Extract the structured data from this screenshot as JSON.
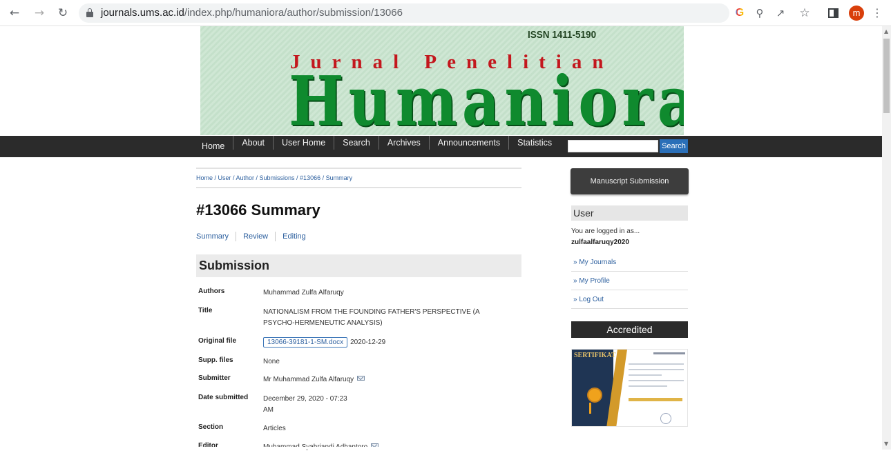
{
  "browser": {
    "url_host": "journals.ums.ac.id",
    "url_path": "/index.php/humaniora/author/submission/13066",
    "avatar_letter": "m"
  },
  "banner": {
    "issn": "ISSN 1411-5190",
    "subtitle": "Jurnal Penelitian",
    "title": "Humaniora"
  },
  "nav": {
    "items": [
      "Home",
      "About",
      "User Home",
      "Search",
      "Archives",
      "Announcements",
      "Statistics"
    ],
    "search_button": "Search"
  },
  "breadcrumb": "Home / User / Author / Submissions / #13066 / Summary",
  "page_title": "#13066 Summary",
  "tabs": [
    "Summary",
    "Review",
    "Editing"
  ],
  "section_title": "Submission",
  "submission": {
    "authors_label": "Authors",
    "authors": "Muhammad Zulfa Alfaruqy",
    "title_label": "Title",
    "title": "NATIONALISM FROM THE FOUNDING FATHER'S PERSPECTIVE (A PSYCHO-HERMENEUTIC ANALYSIS)",
    "original_file_label": "Original file",
    "original_file": "13066-39181-1-SM.docx",
    "original_file_date": "2020-12-29",
    "supp_files_label": "Supp. files",
    "supp_files": "None",
    "submitter_label": "Submitter",
    "submitter": "Mr Muhammad Zulfa Alfaruqy",
    "date_submitted_label": "Date submitted",
    "date_submitted": "December 29, 2020 - 07:23 AM",
    "section_label": "Section",
    "section": "Articles",
    "editor_label": "Editor",
    "editor": "Muhammad Syahriandi Adhantoro"
  },
  "sidebar": {
    "manuscript_button": "Manuscript Submission",
    "user_heading": "User",
    "logged_in_text": "You are logged in as...",
    "username": "zulfaalfaruqy2020",
    "links": [
      "» My Journals",
      "» My Profile",
      "» Log Out"
    ],
    "accredited_heading": "Accredited",
    "certificate_label": "SERTIFIKAT"
  }
}
